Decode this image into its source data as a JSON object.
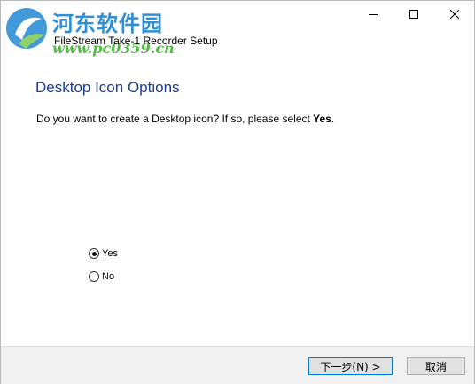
{
  "window": {
    "title": "FileStream Take-1 Recorder Setup",
    "controls": {
      "minimize": "—",
      "maximize": "☐",
      "close": "✕"
    }
  },
  "watermark": {
    "line1": "河东软件园",
    "line2": "www.pc0359.cn"
  },
  "page": {
    "heading": "Desktop Icon Options",
    "description_prefix": "Do you want to create a Desktop icon?  If so, please select ",
    "description_bold": "Yes",
    "description_suffix": "."
  },
  "options": [
    {
      "label": "Yes",
      "selected": true
    },
    {
      "label": "No",
      "selected": false
    }
  ],
  "buttons": {
    "next": "下一步(N) >",
    "cancel": "取消"
  }
}
